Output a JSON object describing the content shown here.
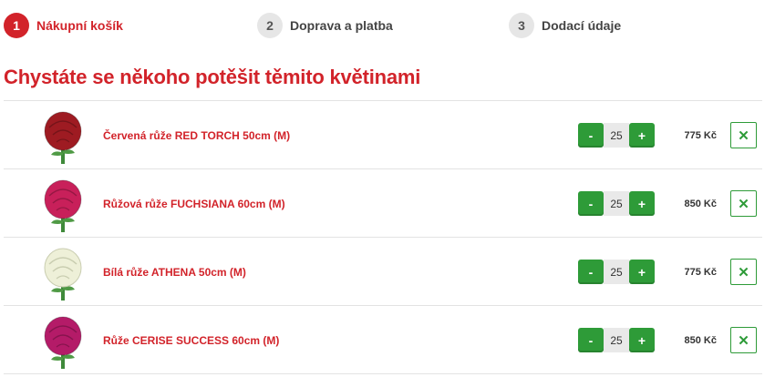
{
  "steps": [
    {
      "number": "1",
      "label": "Nákupní košík"
    },
    {
      "number": "2",
      "label": "Doprava a platba"
    },
    {
      "number": "3",
      "label": "Dodací údaje"
    }
  ],
  "heading": "Chystáte se někoho potěšit těmito květinami",
  "items": [
    {
      "name": "Červená růže RED TORCH 50cm (M)",
      "quantity": "25",
      "price": "775 Kč",
      "color": "#9e1b22"
    },
    {
      "name": "Růžová růže FUCHSIANA 60cm (M)",
      "quantity": "25",
      "price": "850 Kč",
      "color": "#c8205a"
    },
    {
      "name": "Bílá růže ATHENA 50cm (M)",
      "quantity": "25",
      "price": "775 Kč",
      "color": "#eef0d8"
    },
    {
      "name": "Růže CERISE SUCCESS 60cm (M)",
      "quantity": "25",
      "price": "850 Kč",
      "color": "#b41b68"
    }
  ],
  "controls": {
    "minus_label": "-",
    "plus_label": "+",
    "remove_label": "✕"
  },
  "colors": {
    "brand": "#d2232a",
    "accent_green": "#2e9b38"
  },
  "icons": [
    "rose-image",
    "minus-icon",
    "plus-icon",
    "close-icon"
  ]
}
